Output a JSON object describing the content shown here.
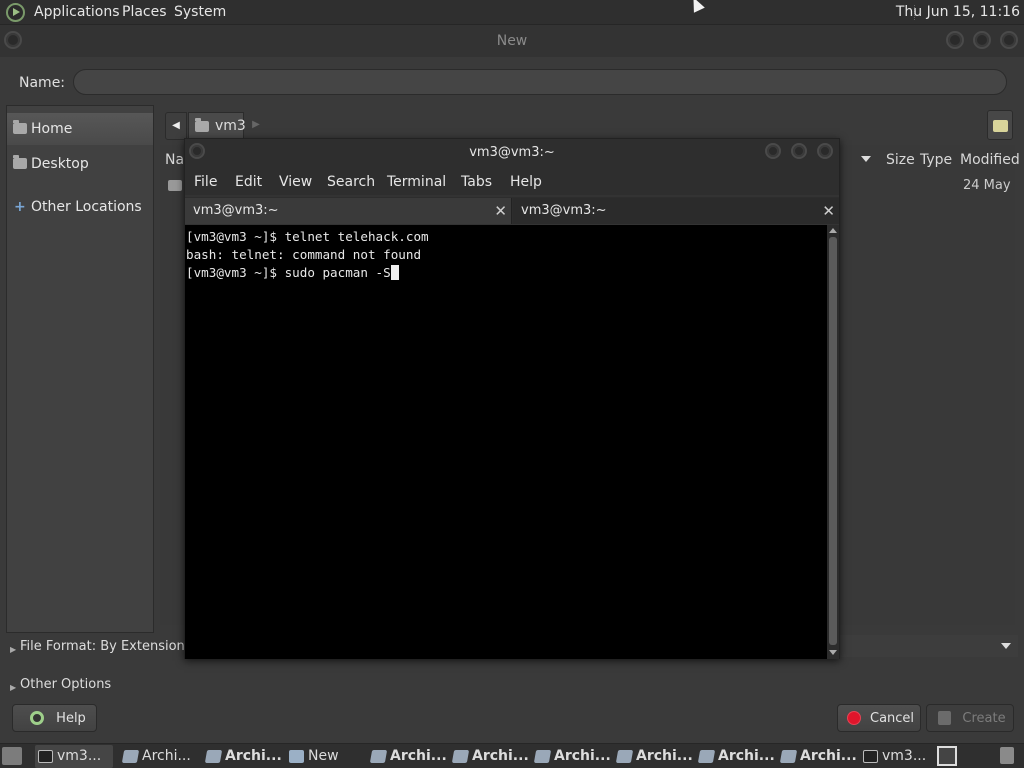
{
  "top_panel": {
    "menus": [
      "Applications",
      "Places",
      "System"
    ],
    "clock": "Thu Jun 15, 11:16"
  },
  "file_dialog": {
    "title": "New",
    "name_label": "Name:",
    "name_value": "",
    "places": [
      {
        "label": "Home",
        "icon": "home-folder-icon",
        "selected": true
      },
      {
        "label": "Desktop",
        "icon": "desktop-folder-icon",
        "selected": false
      },
      {
        "label": "Other Locations",
        "icon": "plus-icon",
        "selected": false
      }
    ],
    "path": {
      "current": "vm3"
    },
    "columns": {
      "name": "Na",
      "size": "Size",
      "type": "Type",
      "modified": "Modified"
    },
    "rows": [
      {
        "modified": "24 May"
      }
    ],
    "file_format_label": "File Format: By Extension",
    "other_options_label": "Other Options",
    "buttons": {
      "help": "Help",
      "cancel": "Cancel",
      "create": "Create"
    }
  },
  "terminal": {
    "title": "vm3@vm3:~",
    "menus": [
      "File",
      "Edit",
      "View",
      "Search",
      "Terminal",
      "Tabs",
      "Help"
    ],
    "tabs": [
      {
        "label": "vm3@vm3:~"
      },
      {
        "label": "vm3@vm3:~"
      }
    ],
    "lines": [
      "[vm3@vm3 ~]$ telnet telehack.com",
      "bash: telnet: command not found",
      "[vm3@vm3 ~]$ sudo pacman -S"
    ]
  },
  "taskbar": {
    "tasks": [
      "vm3...",
      "Archi...",
      "Archi...",
      "New",
      "Archi...",
      "Archi...",
      "Archi...",
      "Archi...",
      "Archi...",
      "Archi...",
      "vm3..."
    ]
  },
  "colors": {
    "accent_cancel": "#e0152b",
    "help_icon": "#9ecf8a",
    "terminal_bg": "#000000"
  }
}
